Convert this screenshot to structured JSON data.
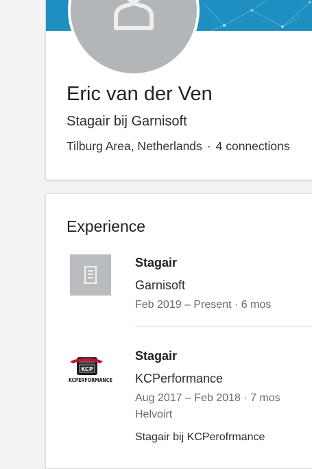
{
  "profile": {
    "name": "Eric van der Ven",
    "headline": "Stagair bij Garnisoft",
    "location": "Tilburg Area, Netherlands",
    "separator": "·",
    "connections": "4 connections"
  },
  "experience": {
    "title": "Experience",
    "items": [
      {
        "title": "Stagair",
        "company": "Garnisoft",
        "dates": "Feb 2019 – Present",
        "duration": "6 mos",
        "logo_icon": "building-icon"
      },
      {
        "title": "Stagair",
        "company": "KCPerformance",
        "dates": "Aug 2017 – Feb 2018",
        "duration": "7 mos",
        "location": "Helvoirt",
        "description": "Stagair bij KCPerofrmance",
        "logo_icon": "kcperformance-logo",
        "logo_text": "KCPERFORMANCE",
        "logo_badge": "KCP"
      }
    ]
  },
  "colors": {
    "banner": "#1e8fc0",
    "avatar_bg": "#b3b6b9",
    "logo_placeholder": "#b9bcbf",
    "meta_text": "#6b6b6b"
  }
}
